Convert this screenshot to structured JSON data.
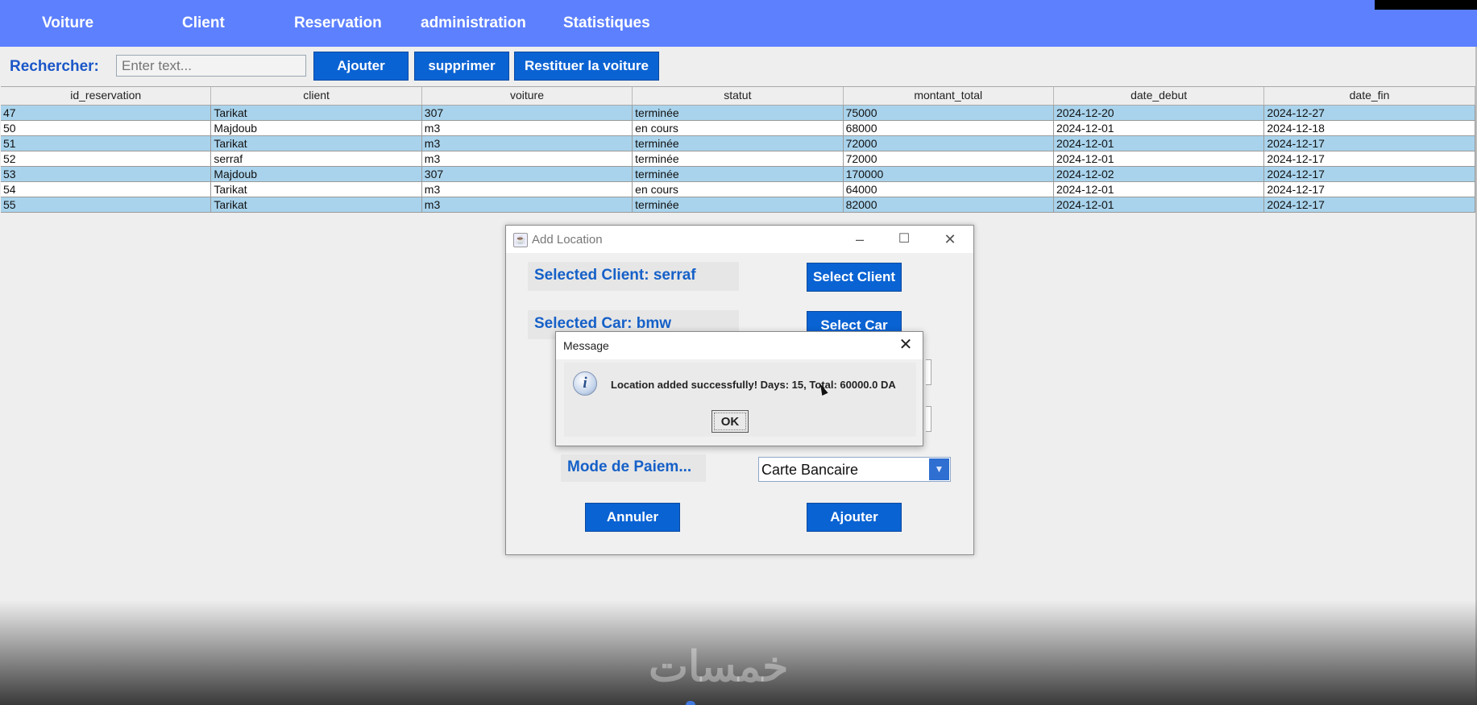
{
  "menu": {
    "items": [
      "Voiture",
      "Client",
      "Reservation",
      "administration",
      "Statistiques"
    ]
  },
  "search": {
    "label": "Rechercher:",
    "placeholder": "Enter text..."
  },
  "toolbar": {
    "add_label": "Ajouter",
    "delete_label": "supprimer",
    "return_label": "Restituer la voiture"
  },
  "table": {
    "columns": [
      "id_reservation",
      "client",
      "voiture",
      "statut",
      "montant_total",
      "date_debut",
      "date_fin"
    ],
    "rows": [
      [
        "47",
        "Tarikat",
        "307",
        "terminée",
        "75000",
        "2024-12-20",
        "2024-12-27"
      ],
      [
        "50",
        "Majdoub",
        "m3",
        "en cours",
        "68000",
        "2024-12-01",
        "2024-12-18"
      ],
      [
        "51",
        "Tarikat",
        "m3",
        "terminée",
        "72000",
        "2024-12-01",
        "2024-12-17"
      ],
      [
        "52",
        "serraf",
        "m3",
        "terminée",
        "72000",
        "2024-12-01",
        "2024-12-17"
      ],
      [
        "53",
        "Majdoub",
        "307",
        "terminée",
        "170000",
        "2024-12-02",
        "2024-12-17"
      ],
      [
        "54",
        "Tarikat",
        "m3",
        "en cours",
        "64000",
        "2024-12-01",
        "2024-12-17"
      ],
      [
        "55",
        "Tarikat",
        "m3",
        "terminée",
        "82000",
        "2024-12-01",
        "2024-12-17"
      ]
    ]
  },
  "add_location_dialog": {
    "title": "Add Location",
    "selected_client": "Selected Client: serraf",
    "selected_car": "Selected Car: bmw",
    "select_client_label": "Select Client",
    "select_car_label": "Select Car",
    "payment_label": "Mode de Paiem...",
    "payment_value": "Carte Bancaire",
    "cancel_label": "Annuler",
    "add_label": "Ajouter"
  },
  "message_dialog": {
    "title": "Message",
    "text": "Location added successfully! Days: 15, Total: 60000.0 DA",
    "ok_label": "OK"
  },
  "icons": {
    "app_icon": "java-cup-icon",
    "info_icon": "info-icon"
  },
  "colors": {
    "menubar": "#5d80ff",
    "button": "#0a63d3",
    "row_highlight": "#a9d3ec",
    "label_text": "#1560c8"
  }
}
